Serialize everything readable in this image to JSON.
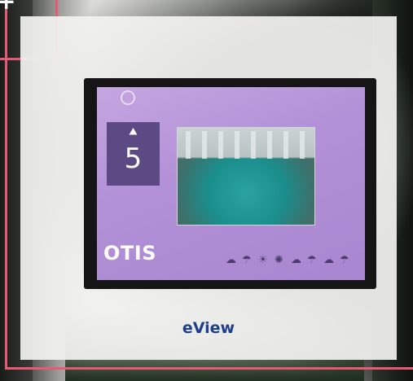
{
  "corner": {
    "plus_symbol": "+"
  },
  "card": {
    "title": "eView"
  },
  "screen": {
    "floor": "5",
    "logo": "OTIS"
  },
  "colors": {
    "frame_accent": "#e45b72",
    "title_text": "#1d3f8c",
    "screen_purple": "#b391d8"
  },
  "icons": [
    "plus-icon",
    "up-arrow-icon",
    "weather-icons"
  ]
}
